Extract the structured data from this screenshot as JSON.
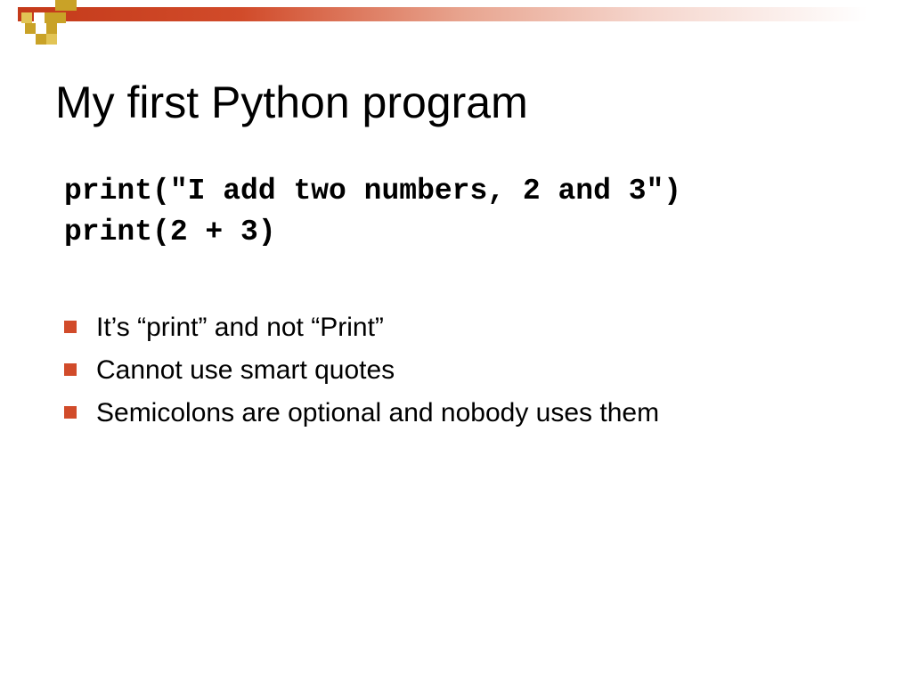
{
  "title": "My first Python program",
  "code": {
    "line1": "print(\"I add two numbers, 2 and 3\")",
    "line2": "print(2 + 3)"
  },
  "bullets": {
    "item1": "It’s “print” and not “Print”",
    "item2": "Cannot use smart quotes",
    "item3": "Semicolons are optional and nobody uses them"
  }
}
